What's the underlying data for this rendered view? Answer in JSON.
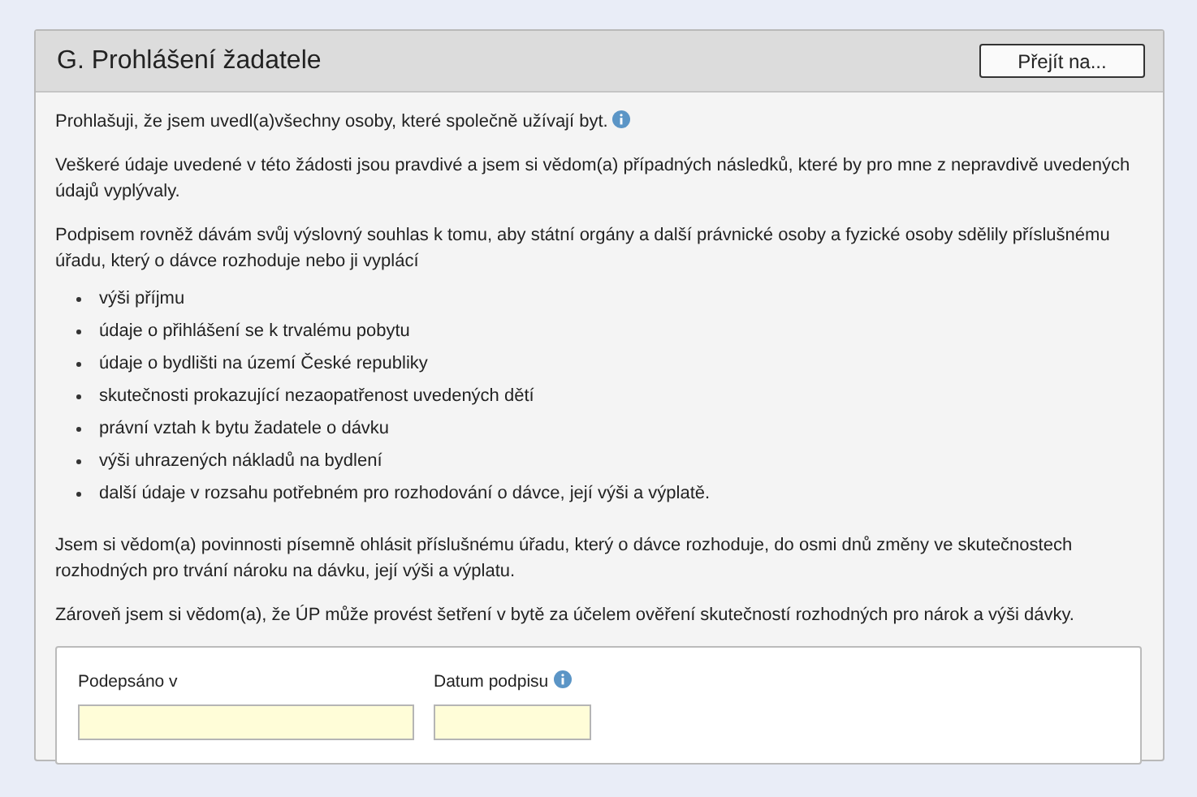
{
  "section": {
    "title": "G. Prohlášení žadatele",
    "goto_button": "Přejít na..."
  },
  "paragraphs_before": [
    {
      "text": "Prohlašuji, že jsem uvedl(a)všechny osoby, které společně užívají byt.",
      "info": true
    },
    {
      "text": "Veškeré údaje uvedené v této žádosti jsou pravdivé a jsem si vědom(a) případných následků, které by pro mne z nepravdivě uvedených údajů vyplývaly.",
      "info": false
    },
    {
      "text": "Podpisem rovněž dávám svůj výslovný souhlas k tomu, aby státní orgány a další právnické osoby a fyzické osoby sdělily příslušnému úřadu, který o dávce rozhoduje nebo ji vyplácí",
      "info": false
    }
  ],
  "list": [
    "výši příjmu",
    "údaje o přihlášení se k trvalému pobytu",
    "údaje o bydlišti na území České republiky",
    "skutečnosti prokazující nezaopatřenost uvedených dětí",
    "právní vztah k bytu žadatele o dávku",
    "výši uhrazených nákladů na bydlení",
    "další údaje v rozsahu potřebném pro rozhodování o dávce, její výši a výplatě."
  ],
  "paragraphs_after": [
    {
      "text": "Jsem si vědom(a) povinnosti písemně ohlásit příslušnému úřadu, který o dávce rozhoduje, do osmi dnů změny ve skutečnostech rozhodných pro trvání nároku na dávku, její výši a výplatu.",
      "info": false
    },
    {
      "text": "Zároveň jsem si vědom(a), že ÚP může provést šetření v bytě za účelem ověření skutečností rozhodných pro nárok a výši dávky.",
      "info": false
    }
  ],
  "fields": [
    {
      "label": "Podepsáno v",
      "info": false,
      "kind": "wide"
    },
    {
      "label": "Datum podpisu",
      "info": true,
      "kind": "narrow"
    }
  ]
}
